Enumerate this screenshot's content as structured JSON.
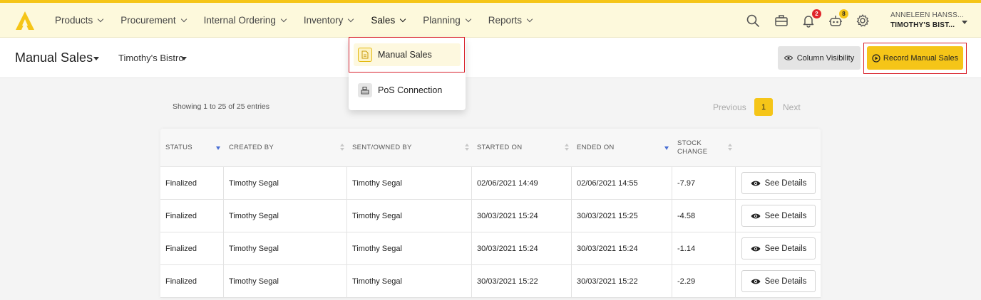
{
  "brand": {
    "accent": "#f5c518",
    "highlight": "#d9232d",
    "logo_icon": "triangle-a-logo"
  },
  "nav": {
    "items": [
      {
        "label": "Products",
        "name": "nav-products"
      },
      {
        "label": "Procurement",
        "name": "nav-procurement"
      },
      {
        "label": "Internal Ordering",
        "name": "nav-internal-ordering"
      },
      {
        "label": "Inventory",
        "name": "nav-inventory"
      },
      {
        "label": "Sales",
        "name": "nav-sales"
      },
      {
        "label": "Planning",
        "name": "nav-planning"
      },
      {
        "label": "Reports",
        "name": "nav-reports"
      }
    ],
    "active": "Sales"
  },
  "header_icons": {
    "notifications_count": "2",
    "tasks_count": "8"
  },
  "user": {
    "name": "ANNELEEN HANSS...",
    "location": "TIMOTHY'S BIST..."
  },
  "subheader": {
    "title": "Manual Sales",
    "location": "Timothy's Bistro",
    "column_visibility_label": "Column Visibility",
    "record_label": "Record Manual Sales"
  },
  "dropdown": {
    "items": [
      {
        "label": "Manual Sales"
      },
      {
        "label": "PoS Connection"
      }
    ]
  },
  "table_info": {
    "showing": "Showing 1 to 25 of 25 entries",
    "prev": "Previous",
    "page": "1",
    "next": "Next"
  },
  "table": {
    "columns": [
      "STATUS",
      "CREATED BY",
      "SENT/OWNED BY",
      "STARTED ON",
      "ENDED ON",
      "STOCK CHANGE"
    ],
    "rows": [
      {
        "status": "Finalized",
        "created_by": "Timothy Segal",
        "owned_by": "Timothy Segal",
        "started_on": "02/06/2021 14:49",
        "ended_on": "02/06/2021 14:55",
        "stock_change": "-7.97"
      },
      {
        "status": "Finalized",
        "created_by": "Timothy Segal",
        "owned_by": "Timothy Segal",
        "started_on": "30/03/2021 15:24",
        "ended_on": "30/03/2021 15:25",
        "stock_change": "-4.58"
      },
      {
        "status": "Finalized",
        "created_by": "Timothy Segal",
        "owned_by": "Timothy Segal",
        "started_on": "30/03/2021 15:24",
        "ended_on": "30/03/2021 15:24",
        "stock_change": "-1.14"
      },
      {
        "status": "Finalized",
        "created_by": "Timothy Segal",
        "owned_by": "Timothy Segal",
        "started_on": "30/03/2021 15:22",
        "ended_on": "30/03/2021 15:22",
        "stock_change": "-2.29"
      }
    ],
    "action_label": "See Details"
  }
}
